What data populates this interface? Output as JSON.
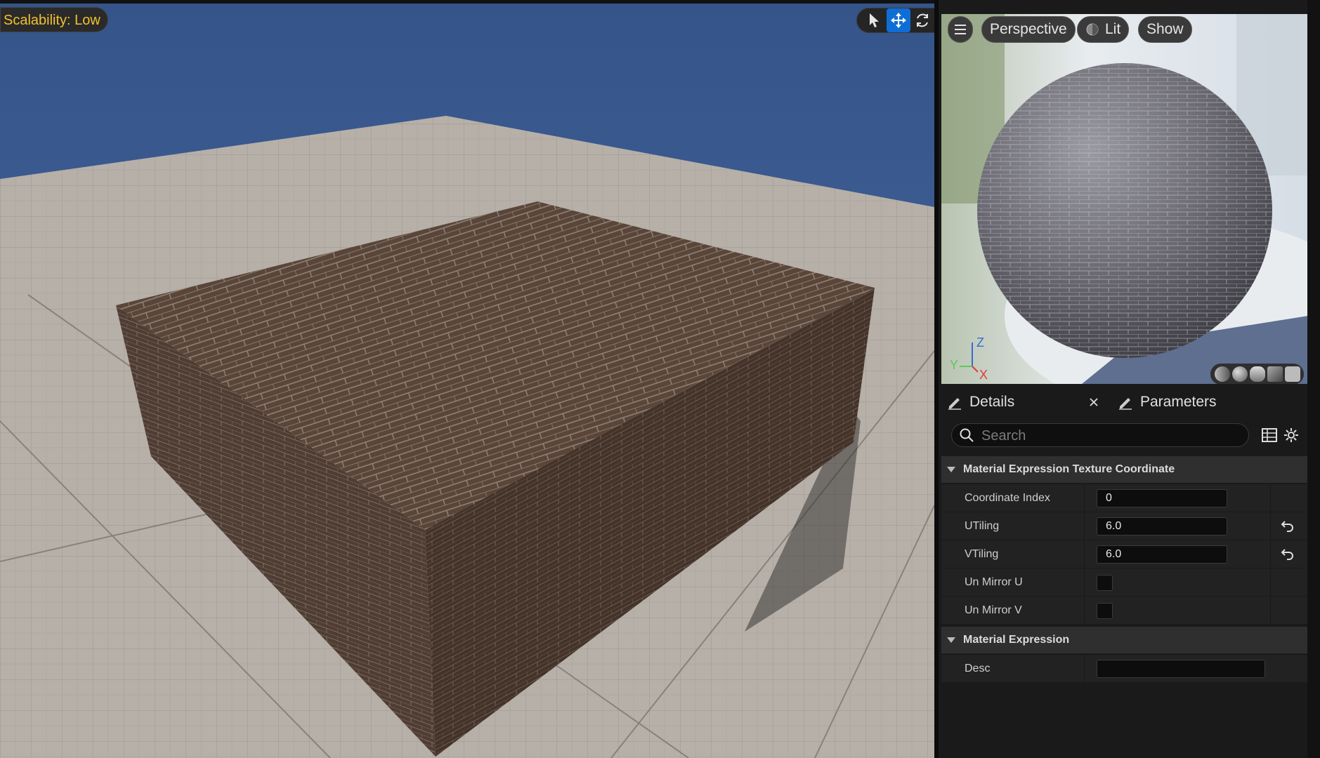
{
  "viewport": {
    "scalability_label": "Scalability: Low",
    "tools": [
      {
        "name": "select-tool",
        "icon": "cursor-arrow-icon",
        "active": false
      },
      {
        "name": "move-tool",
        "icon": "move-arrows-icon",
        "active": true
      },
      {
        "name": "rotate-tool",
        "icon": "rotate-icon",
        "active": false
      }
    ]
  },
  "preview": {
    "perspective_label": "Perspective",
    "lit_label": "Lit",
    "show_label": "Show",
    "axis": {
      "z": "Z",
      "y": "Y",
      "x": "X"
    }
  },
  "tabs": {
    "details_label": "Details",
    "parameters_label": "Parameters"
  },
  "search": {
    "placeholder": "Search",
    "value": ""
  },
  "sections": [
    {
      "title": "Material Expression Texture Coordinate",
      "rows": [
        {
          "label": "Coordinate Index",
          "value": "0",
          "type": "number",
          "reset": false
        },
        {
          "label": "UTiling",
          "value": "6.0",
          "type": "number",
          "reset": true
        },
        {
          "label": "VTiling",
          "value": "6.0",
          "type": "number",
          "reset": true
        },
        {
          "label": "Un Mirror U",
          "value": "",
          "type": "checkbox",
          "checked": false
        },
        {
          "label": "Un Mirror V",
          "value": "",
          "type": "checkbox",
          "checked": false
        }
      ]
    },
    {
      "title": "Material Expression",
      "rows": [
        {
          "label": "Desc",
          "value": "",
          "type": "text"
        }
      ]
    }
  ],
  "colors": {
    "accent": "#0e6ed6",
    "scalability_text": "#f2c12e",
    "sky": "#3f5f91",
    "brick": "#5a4538",
    "floor": "#b9b2aa"
  }
}
